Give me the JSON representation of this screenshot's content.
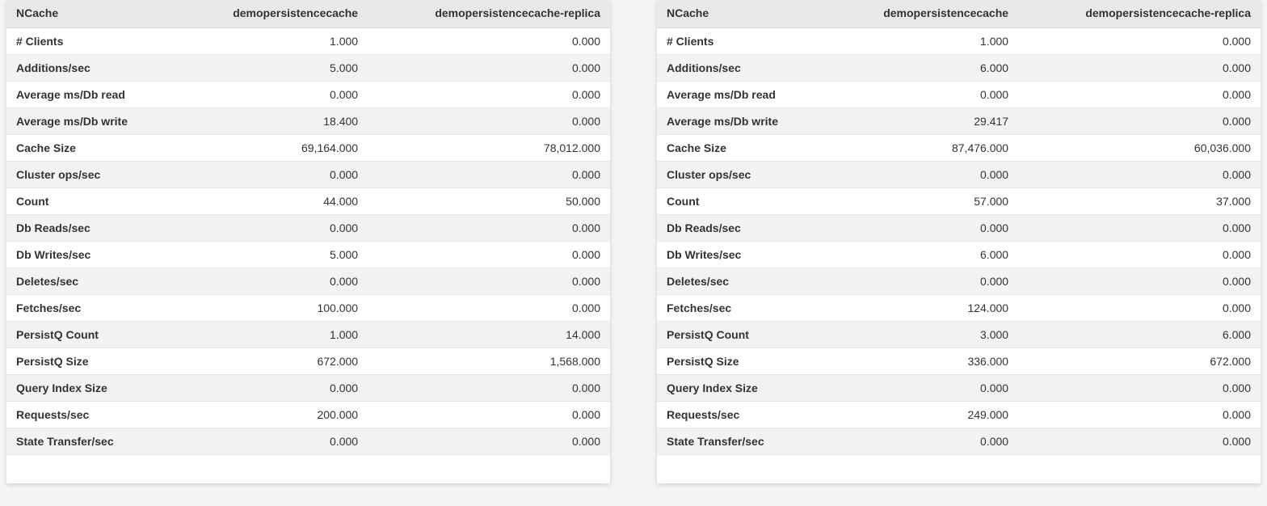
{
  "panels": [
    {
      "headers": [
        "NCache",
        "demopersistencecache",
        "demopersistencecache-replica"
      ],
      "rows": [
        {
          "label": "# Clients",
          "v1": "1.000",
          "v2": "0.000"
        },
        {
          "label": "Additions/sec",
          "v1": "5.000",
          "v2": "0.000"
        },
        {
          "label": "Average ms/Db read",
          "v1": "0.000",
          "v2": "0.000"
        },
        {
          "label": "Average ms/Db write",
          "v1": "18.400",
          "v2": "0.000"
        },
        {
          "label": "Cache Size",
          "v1": "69,164.000",
          "v2": "78,012.000"
        },
        {
          "label": "Cluster ops/sec",
          "v1": "0.000",
          "v2": "0.000"
        },
        {
          "label": "Count",
          "v1": "44.000",
          "v2": "50.000"
        },
        {
          "label": "Db Reads/sec",
          "v1": "0.000",
          "v2": "0.000"
        },
        {
          "label": "Db Writes/sec",
          "v1": "5.000",
          "v2": "0.000"
        },
        {
          "label": "Deletes/sec",
          "v1": "0.000",
          "v2": "0.000"
        },
        {
          "label": "Fetches/sec",
          "v1": "100.000",
          "v2": "0.000"
        },
        {
          "label": "PersistQ Count",
          "v1": "1.000",
          "v2": "14.000"
        },
        {
          "label": "PersistQ Size",
          "v1": "672.000",
          "v2": "1,568.000"
        },
        {
          "label": "Query Index Size",
          "v1": "0.000",
          "v2": "0.000"
        },
        {
          "label": "Requests/sec",
          "v1": "200.000",
          "v2": "0.000"
        },
        {
          "label": "State Transfer/sec",
          "v1": "0.000",
          "v2": "0.000"
        }
      ]
    },
    {
      "headers": [
        "NCache",
        "demopersistencecache",
        "demopersistencecache-replica"
      ],
      "rows": [
        {
          "label": "# Clients",
          "v1": "1.000",
          "v2": "0.000"
        },
        {
          "label": "Additions/sec",
          "v1": "6.000",
          "v2": "0.000"
        },
        {
          "label": "Average ms/Db read",
          "v1": "0.000",
          "v2": "0.000"
        },
        {
          "label": "Average ms/Db write",
          "v1": "29.417",
          "v2": "0.000"
        },
        {
          "label": "Cache Size",
          "v1": "87,476.000",
          "v2": "60,036.000"
        },
        {
          "label": "Cluster ops/sec",
          "v1": "0.000",
          "v2": "0.000"
        },
        {
          "label": "Count",
          "v1": "57.000",
          "v2": "37.000"
        },
        {
          "label": "Db Reads/sec",
          "v1": "0.000",
          "v2": "0.000"
        },
        {
          "label": "Db Writes/sec",
          "v1": "6.000",
          "v2": "0.000"
        },
        {
          "label": "Deletes/sec",
          "v1": "0.000",
          "v2": "0.000"
        },
        {
          "label": "Fetches/sec",
          "v1": "124.000",
          "v2": "0.000"
        },
        {
          "label": "PersistQ Count",
          "v1": "3.000",
          "v2": "6.000"
        },
        {
          "label": "PersistQ Size",
          "v1": "336.000",
          "v2": "672.000"
        },
        {
          "label": "Query Index Size",
          "v1": "0.000",
          "v2": "0.000"
        },
        {
          "label": "Requests/sec",
          "v1": "249.000",
          "v2": "0.000"
        },
        {
          "label": "State Transfer/sec",
          "v1": "0.000",
          "v2": "0.000"
        }
      ]
    }
  ]
}
